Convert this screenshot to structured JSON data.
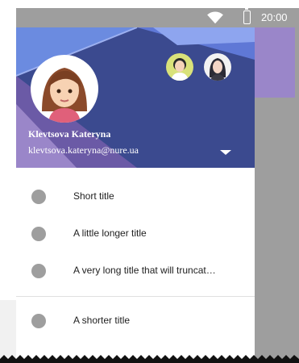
{
  "status_bar": {
    "time": "20:00",
    "wifi_icon": "wifi-icon",
    "battery_icon": "battery-icon"
  },
  "drawer_header": {
    "user_name": "Klevtsova Kateryna",
    "user_email": "klevtsova.kateryna@nure.ua",
    "dropdown_icon": "arrow-drop-down-icon",
    "colors": {
      "primary": "#3b4a8f",
      "light": "#5b6fcf",
      "accent": "#9a86c9"
    }
  },
  "menu": {
    "items": [
      {
        "label": "Short title",
        "icon": "circle-icon"
      },
      {
        "label": "A little longer title",
        "icon": "circle-icon"
      },
      {
        "label": "A very long title that will truncat…",
        "icon": "circle-icon"
      },
      {
        "label": "A shorter title",
        "icon": "circle-icon"
      }
    ]
  }
}
